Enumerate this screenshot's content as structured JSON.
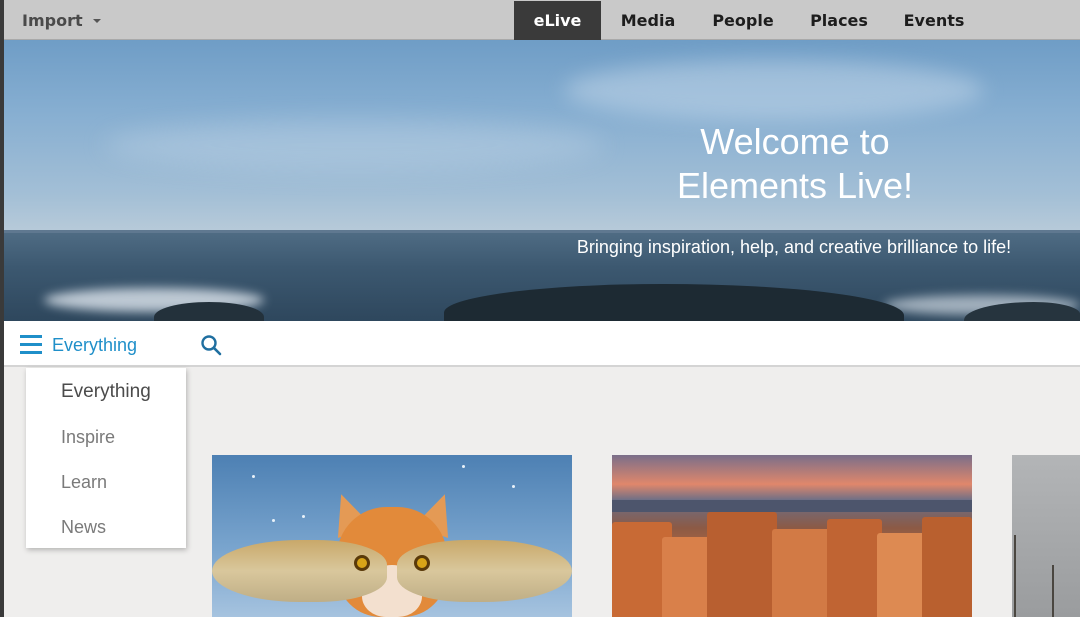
{
  "topbar": {
    "import_label": "Import",
    "tabs": [
      {
        "label": "eLive",
        "active": true
      },
      {
        "label": "Media",
        "active": false
      },
      {
        "label": "People",
        "active": false
      },
      {
        "label": "Places",
        "active": false
      },
      {
        "label": "Events",
        "active": false
      }
    ]
  },
  "hero": {
    "title_line1": "Welcome to",
    "title_line2": "Elements Live!",
    "subtitle": "Bringing inspiration, help, and creative brilliance to life!"
  },
  "filter": {
    "selected": "Everything",
    "options": [
      "Everything",
      "Inspire",
      "Learn",
      "News"
    ]
  },
  "cards": [
    {
      "image": "cat-with-fish"
    },
    {
      "image": "canyon-hoodoos-sunset"
    },
    {
      "image": "grey-sky-tree"
    }
  ],
  "colors": {
    "accent": "#1f8fc9",
    "active_tab_bg": "#3a3a3a",
    "topbar_bg": "#c9c9c9",
    "content_bg": "#efeeed"
  }
}
